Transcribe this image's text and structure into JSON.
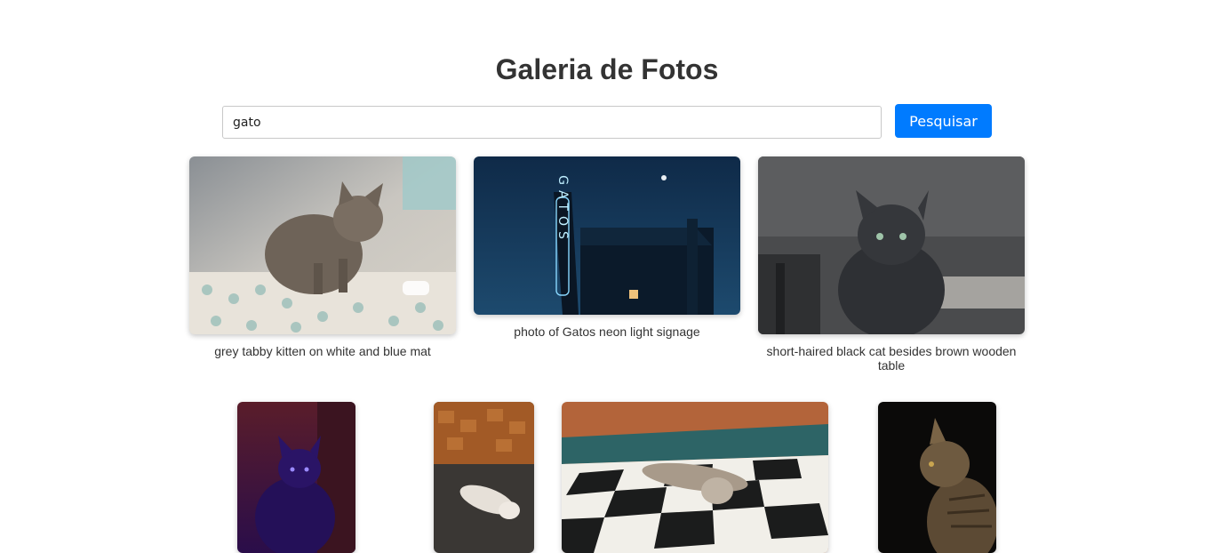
{
  "page": {
    "title": "Galeria de Fotos"
  },
  "search": {
    "value": "gato",
    "button_label": "Pesquisar"
  },
  "colors": {
    "accent": "#007bff",
    "title": "#333333"
  },
  "gallery": {
    "photos": [
      {
        "caption": "grey tabby kitten on white and blue mat"
      },
      {
        "caption": "photo of Gatos neon light signage",
        "sign_text": "GATOS"
      },
      {
        "caption": "short-haired black cat besides brown wooden table"
      },
      {
        "caption": ""
      },
      {
        "caption": ""
      },
      {
        "caption": ""
      },
      {
        "caption": ""
      }
    ]
  }
}
